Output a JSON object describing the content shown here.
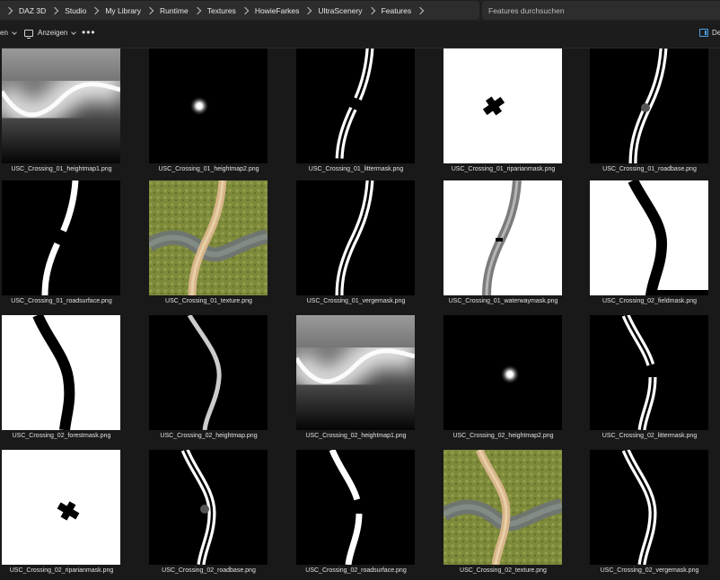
{
  "breadcrumb": [
    "DAZ 3D",
    "Studio",
    "My Library",
    "Runtime",
    "Textures",
    "HowieFarkes",
    "UltraScenery",
    "Features"
  ],
  "search": {
    "placeholder": "Features durchsuchen"
  },
  "commandbar": {
    "sort_label": "en",
    "view_label": "Anzeigen",
    "more_label": "•••",
    "details_label": "De"
  },
  "files": [
    {
      "name": "USC_Crossing_01_heightmap1.png",
      "thumb": "heightwave",
      "variant": 1
    },
    {
      "name": "USC_Crossing_01_heightmap2.png",
      "thumb": "dot",
      "variant": 1
    },
    {
      "name": "USC_Crossing_01_littermask.png",
      "thumb": "litter",
      "variant": 1
    },
    {
      "name": "USC_Crossing_01_riparianmask.png",
      "thumb": "riparian",
      "variant": 1
    },
    {
      "name": "USC_Crossing_01_roadbase.png",
      "thumb": "roadbase",
      "variant": 1
    },
    {
      "name": "USC_Crossing_01_roadsurface.png",
      "thumb": "roadsurface",
      "variant": 1
    },
    {
      "name": "USC_Crossing_01_texture.png",
      "thumb": "texture",
      "variant": 1
    },
    {
      "name": "USC_Crossing_01_vergemask.png",
      "thumb": "verge",
      "variant": 1
    },
    {
      "name": "USC_Crossing_01_waterwaymask.png",
      "thumb": "waterway",
      "variant": 1
    },
    {
      "name": "USC_Crossing_02_fieldmask.png",
      "thumb": "field",
      "variant": 2
    },
    {
      "name": "USC_Crossing_02_forestmask.png",
      "thumb": "forest",
      "variant": 2
    },
    {
      "name": "USC_Crossing_02_heightmap.png",
      "thumb": "heightroad",
      "variant": 2
    },
    {
      "name": "USC_Crossing_02_heightmap1.png",
      "thumb": "heightwave",
      "variant": 2
    },
    {
      "name": "USC_Crossing_02_heightmap2.png",
      "thumb": "dot",
      "variant": 2
    },
    {
      "name": "USC_Crossing_02_littermask.png",
      "thumb": "litter",
      "variant": 2
    },
    {
      "name": "USC_Crossing_02_riparianmask.png",
      "thumb": "riparian",
      "variant": 2
    },
    {
      "name": "USC_Crossing_02_roadbase.png",
      "thumb": "roadbase",
      "variant": 2
    },
    {
      "name": "USC_Crossing_02_roadsurface.png",
      "thumb": "roadsurface",
      "variant": 2
    },
    {
      "name": "USC_Crossing_02_texture.png",
      "thumb": "texture",
      "variant": 2
    },
    {
      "name": "USC_Crossing_02_vergemask.png",
      "thumb": "verge",
      "variant": 2
    }
  ],
  "icons": {
    "breadcrumb_separator": "chevron-right-icon",
    "view": "monitor-icon",
    "details": "details-pane-icon"
  }
}
